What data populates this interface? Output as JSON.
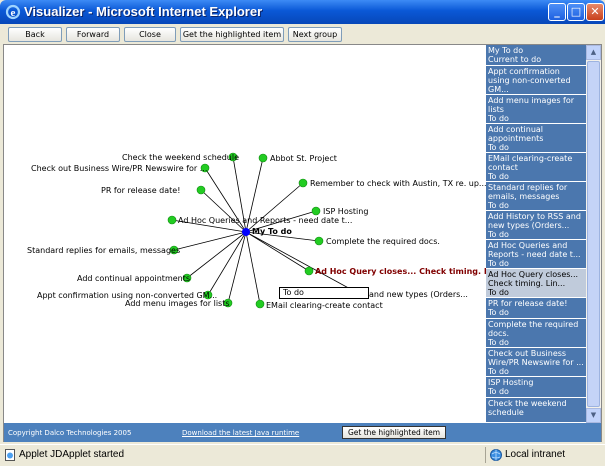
{
  "window": {
    "title": "Visualizer - Microsoft Internet Explorer",
    "minimize": "_",
    "maximize": "□",
    "close": "✕"
  },
  "toolbar": {
    "back": "Back",
    "forward": "Forward",
    "close": "Close",
    "get_highlighted": "Get the highlighted item",
    "next_group": "Next group"
  },
  "graph": {
    "center_label": "My To do",
    "tooltip": "To do",
    "nodes": [
      "Check the weekend schedule",
      "Abbot St. Project",
      "Check out Business Wire/PR Newswire for ...",
      "Remember to check with Austin, TX re. up...",
      "PR for release date!",
      "ISP Hosting",
      "Ad Hoc Queries and Reports - need date t...",
      "Complete the required docs.",
      "Standard replies for emails, messages",
      "Ad Hoc Query closes... Check timing. Lin...",
      "Add continual appointments",
      "and new types (Orders...",
      "Appt confirmation using non-converted GM...",
      "Add menu images for lists",
      "EMail clearing-create contact"
    ],
    "colors": {
      "node": "#22cc22",
      "center": "#0000ff",
      "edge": "#000000",
      "hot_label": "#800000"
    }
  },
  "list": {
    "items": [
      {
        "name": "My To do",
        "sub": "Current to do"
      },
      {
        "name": "Appt confirmation using non-converted GM...",
        "sub": "To do"
      },
      {
        "name": "Add menu images for lists",
        "sub": "To do"
      },
      {
        "name": "Add continual appointments",
        "sub": "To do"
      },
      {
        "name": "EMail clearing-create contact",
        "sub": "To do"
      },
      {
        "name": "Standard replies for emails, messages",
        "sub": "To do"
      },
      {
        "name": "Add History to RSS and new types (Orders...",
        "sub": "To do"
      },
      {
        "name": "Ad Hoc Queries and Reports - need date t...",
        "sub": "To do"
      },
      {
        "name": "Ad Hoc Query closes... Check timing. Lin...",
        "sub": "To do"
      },
      {
        "name": "PR for release date!",
        "sub": "To do"
      },
      {
        "name": "Complete the required docs.",
        "sub": "To do"
      },
      {
        "name": "Check out Business Wire/PR Newswire for ...",
        "sub": "To do"
      },
      {
        "name": "ISP Hosting",
        "sub": "To do"
      },
      {
        "name": "Check the weekend schedule",
        "sub": ""
      }
    ],
    "colors": {
      "item_bg": "#4b77ae",
      "selected_bg": "#c0cbdb"
    }
  },
  "footer": {
    "copyright": "Copyright Dalco Technologies 2005",
    "download_link": "Download the latest Java runtime",
    "get_highlighted": "Get the highlighted item"
  },
  "statusbar": {
    "text": "Applet JDApplet started",
    "zone": "Local intranet"
  }
}
